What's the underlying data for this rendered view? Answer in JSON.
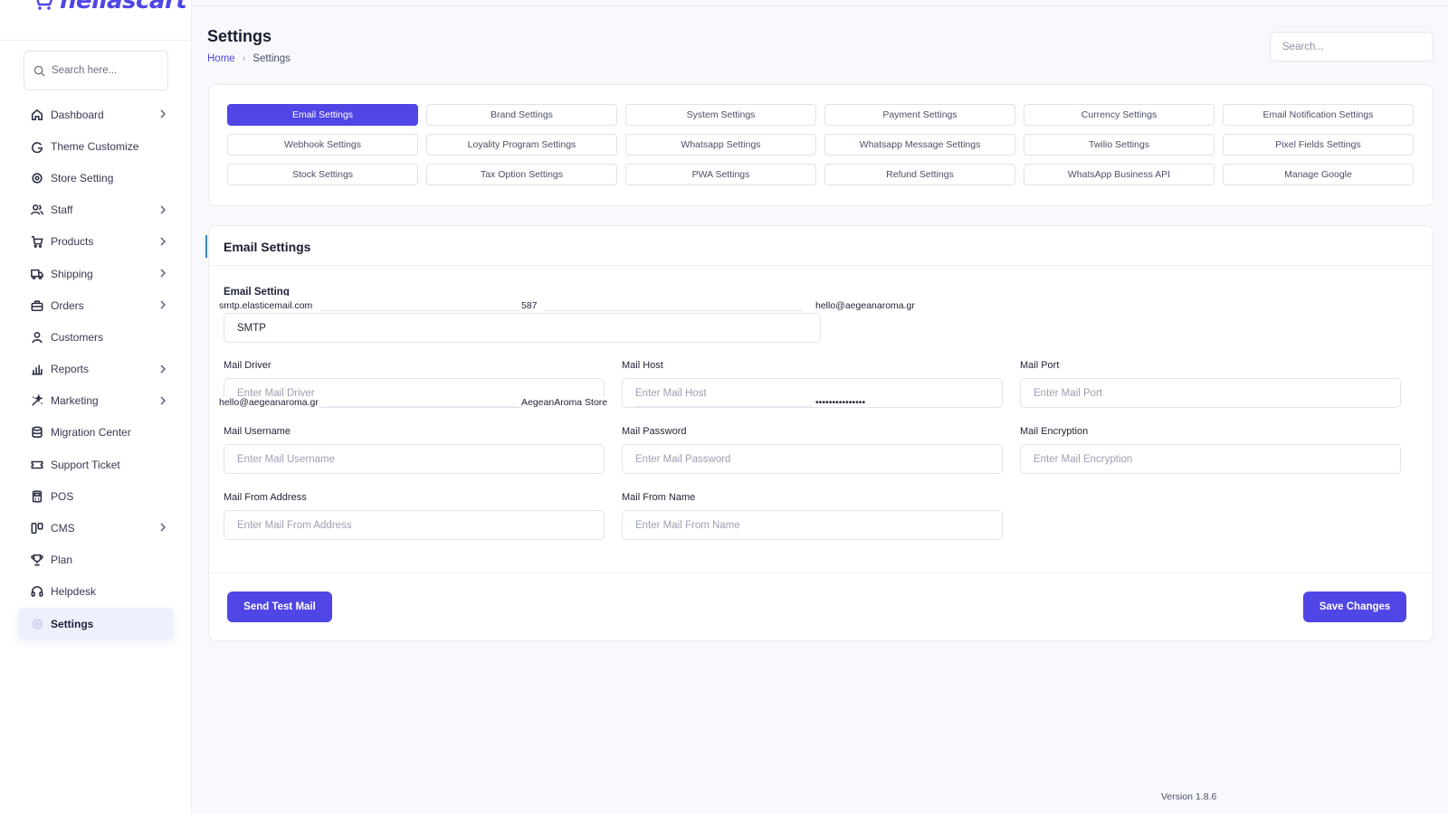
{
  "brand": {
    "name": "hellascart",
    "color": "#4f46e5"
  },
  "sidebar": {
    "search_placeholder": "Search here...",
    "items": [
      {
        "label": "Dashboard",
        "icon": "home-icon",
        "chevron": true
      },
      {
        "label": "Theme Customize",
        "icon": "palette-icon",
        "chevron": false
      },
      {
        "label": "Store Setting",
        "icon": "gear-icon",
        "chevron": false
      },
      {
        "label": "Staff",
        "icon": "users-icon",
        "chevron": true
      },
      {
        "label": "Products",
        "icon": "cart-icon",
        "chevron": true
      },
      {
        "label": "Shipping",
        "icon": "truck-icon",
        "chevron": true
      },
      {
        "label": "Orders",
        "icon": "briefcase-icon",
        "chevron": true
      },
      {
        "label": "Customers",
        "icon": "user-icon",
        "chevron": false
      },
      {
        "label": "Reports",
        "icon": "chart-icon",
        "chevron": true
      },
      {
        "label": "Marketing",
        "icon": "sparkle-icon",
        "chevron": true
      },
      {
        "label": "Migration Center",
        "icon": "database-icon",
        "chevron": false
      },
      {
        "label": "Support Ticket",
        "icon": "ticket-icon",
        "chevron": false
      },
      {
        "label": "POS",
        "icon": "pos-icon",
        "chevron": false
      },
      {
        "label": "CMS",
        "icon": "cms-icon",
        "chevron": true
      },
      {
        "label": "Plan",
        "icon": "trophy-icon",
        "chevron": false
      },
      {
        "label": "Helpdesk",
        "icon": "headset-icon",
        "chevron": false
      },
      {
        "label": "Settings",
        "icon": "settings-icon",
        "chevron": false,
        "active": true
      }
    ]
  },
  "header": {
    "title": "Settings",
    "breadcrumb": {
      "home": "Home",
      "separator": "›",
      "current": "Settings"
    },
    "search_placeholder": "Search..."
  },
  "tabs": [
    {
      "label": "Email Settings",
      "active": true
    },
    {
      "label": "Brand Settings"
    },
    {
      "label": "System Settings"
    },
    {
      "label": "Payment Settings"
    },
    {
      "label": "Currency Settings"
    },
    {
      "label": "Email Notification Settings"
    },
    {
      "label": "Webhook Settings"
    },
    {
      "label": "Loyality Program Settings"
    },
    {
      "label": "Whatsapp Settings"
    },
    {
      "label": "Whatsapp Message Settings"
    },
    {
      "label": "Twilio Settings"
    },
    {
      "label": "Pixel Fields Settings"
    },
    {
      "label": "Stock Settings"
    },
    {
      "label": "Tax Option Settings"
    },
    {
      "label": "PWA Settings"
    },
    {
      "label": "Refund Settings"
    },
    {
      "label": "WhatsApp Business API"
    },
    {
      "label": "Manage Google"
    }
  ],
  "email_card": {
    "title": "Email Settings",
    "section_label": "Email Setting",
    "driver_select_value": "SMTP",
    "autofill_row1": [
      "smtp.elasticemail.com",
      "587",
      "hello@aegeanaroma.gr"
    ],
    "autofill_row2": [
      "hello@aegeanaroma.gr",
      "AegeanAroma Store",
      "•••••••••••••••"
    ],
    "fields": {
      "mail_driver": {
        "label": "Mail Driver",
        "placeholder": "Enter Mail Driver"
      },
      "mail_host": {
        "label": "Mail Host",
        "placeholder": "Enter Mail Host"
      },
      "mail_port": {
        "label": "Mail Port",
        "placeholder": "Enter Mail Port"
      },
      "mail_username": {
        "label": "Mail Username",
        "placeholder": "Enter Mail Username"
      },
      "mail_password": {
        "label": "Mail Password",
        "placeholder": "Enter Mail Password"
      },
      "mail_encryption": {
        "label": "Mail Encryption",
        "placeholder": "Enter Mail Encryption"
      },
      "mail_from_address": {
        "label": "Mail From Address",
        "placeholder": "Enter Mail From Address"
      },
      "mail_from_name": {
        "label": "Mail From Name",
        "placeholder": "Enter Mail From Name"
      }
    },
    "send_test_label": "Send Test Mail",
    "save_label": "Save Changes"
  },
  "footer": {
    "version": "Version 1.8.6"
  }
}
